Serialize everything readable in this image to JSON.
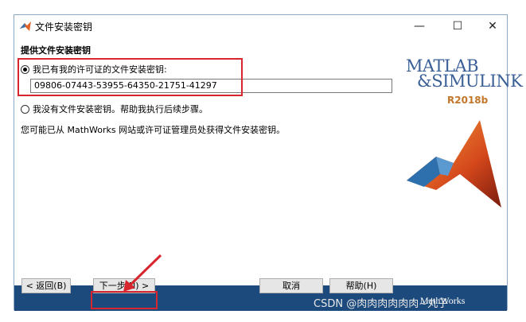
{
  "window": {
    "title": "文件安装密钥"
  },
  "heading": "提供文件安装密钥",
  "option_have_key": "我已有我的许可证的文件安装密钥:",
  "key_value": "09806-07443-53955-64350-21751-41297",
  "option_no_key": "我没有文件安装密钥。帮助我执行后续步骤。",
  "info_text": "您可能已从 MathWorks 网站或许可证管理员处获得文件安装密钥。",
  "logo": {
    "line1": "MATLAB",
    "line2": "&SIMULINK",
    "release": "R2018b"
  },
  "buttons": {
    "back": "< 返回(B)",
    "next": "下一步(N) >",
    "cancel": "取消",
    "help": "帮助(H)"
  },
  "footer_logo": "MathWorks",
  "watermark": "CSDN @肉肉肉肉肉肉~丸子"
}
